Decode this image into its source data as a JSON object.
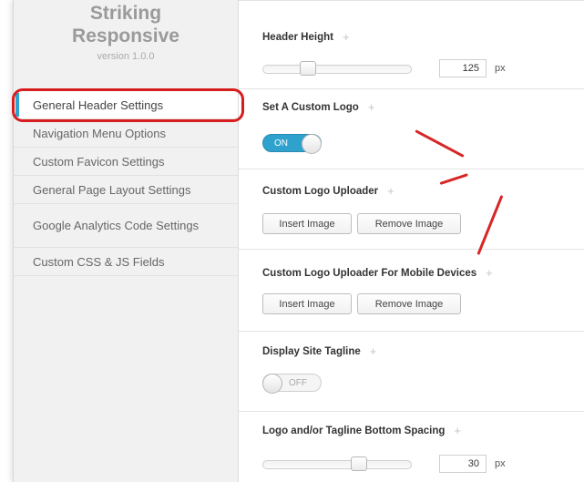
{
  "brand": {
    "line1": "Striking",
    "line2": "Responsive",
    "version": "version 1.0.0"
  },
  "nav": {
    "items": [
      {
        "label": "General Header Settings"
      },
      {
        "label": "Navigation Menu Options"
      },
      {
        "label": "Custom Favicon Settings"
      },
      {
        "label": "General Page Layout Settings"
      },
      {
        "label": "Google Analytics Code Settings"
      },
      {
        "label": "Custom CSS & JS Fields"
      }
    ],
    "active_index": 0
  },
  "content": {
    "plus_icon": "+",
    "header_height": {
      "title": "Header Height",
      "value": "125",
      "unit": "px",
      "level": 0.28
    },
    "custom_logo": {
      "title": "Set A Custom Logo",
      "toggle_label": "ON",
      "state": "on"
    },
    "logo_uploader": {
      "title": "Custom Logo Uploader",
      "insert_label": "Insert Image",
      "remove_label": "Remove Image"
    },
    "mobile_uploader": {
      "title": "Custom Logo Uploader For Mobile Devices",
      "insert_label": "Insert Image",
      "remove_label": "Remove Image"
    },
    "site_tagline": {
      "title": "Display Site Tagline",
      "toggle_label": "OFF",
      "state": "off"
    },
    "bottom_spacing": {
      "title": "Logo and/or Tagline Bottom Spacing",
      "value": "30",
      "unit": "px",
      "level": 0.67
    }
  },
  "colors": {
    "accent": "#2ea2cc",
    "annotation": "#d62626"
  }
}
